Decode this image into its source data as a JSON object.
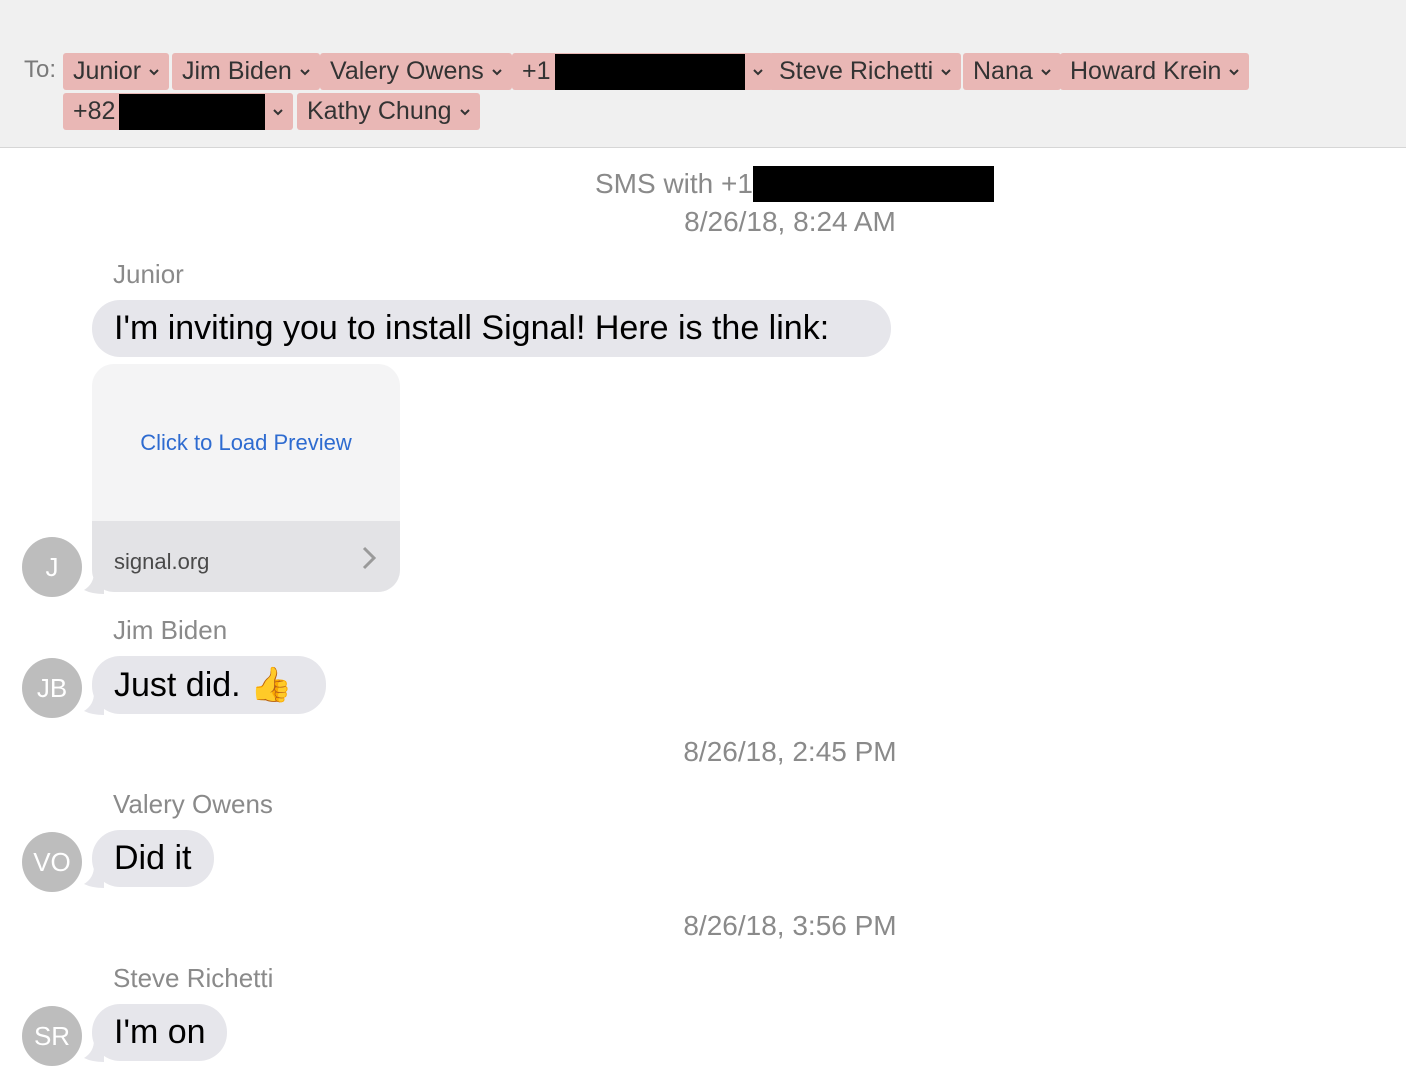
{
  "header": {
    "to_label": "To:",
    "recipients": [
      {
        "label": "Junior"
      },
      {
        "label": "Jim Biden"
      },
      {
        "label": "Valery Owens"
      },
      {
        "label": "+1"
      },
      {
        "label": "Steve Richetti"
      },
      {
        "label": "Nana"
      },
      {
        "label": "Howard Krein"
      },
      {
        "label": "+82"
      },
      {
        "label": "Kathy Chung"
      }
    ]
  },
  "conversation": {
    "sms_with": "SMS with +1",
    "timestamps": [
      "8/26/18, 8:24 AM",
      "8/26/18, 2:45 PM",
      "8/26/18, 3:56 PM"
    ],
    "messages": [
      {
        "sender": "Junior",
        "initials": "J",
        "text": "I'm inviting you to install Signal! Here is the link:"
      },
      {
        "sender": "Jim Biden",
        "initials": "JB",
        "text": "Just did. 👍"
      },
      {
        "sender": "Valery Owens",
        "initials": "VO",
        "text": "Did it"
      },
      {
        "sender": "Steve Richetti",
        "initials": "SR",
        "text": "I'm on"
      }
    ],
    "link_preview": {
      "load_label": "Click to Load Preview",
      "domain": "signal.org"
    }
  },
  "colors": {
    "chip": "#e9b7b5",
    "bubble": "#e6e6eb",
    "avatar": "#bdbdbd",
    "link": "#2e6bd0",
    "header_bg": "#f0f0f0"
  },
  "icons": [
    "chevron-down-icon",
    "chevron-right-icon"
  ]
}
